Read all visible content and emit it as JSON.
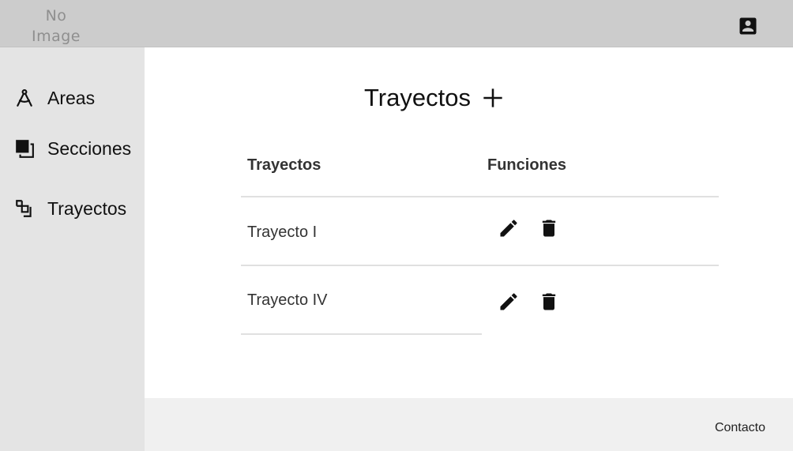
{
  "header": {
    "logo_line1": "No",
    "logo_line2": "Image",
    "account_icon": "account-box-icon"
  },
  "sidebar": {
    "items": [
      {
        "label": "Areas",
        "icon": "compass-icon"
      },
      {
        "label": "Secciones",
        "icon": "layers-icon"
      },
      {
        "label": "Trayectos",
        "icon": "flip-to-front-icon"
      }
    ]
  },
  "main": {
    "title": "Trayectos",
    "add_icon": "plus-icon",
    "table": {
      "columns": [
        "Trayectos",
        "Funciones"
      ],
      "rows": [
        {
          "name": "Trayecto I",
          "actions": [
            "edit-icon",
            "delete-icon"
          ]
        },
        {
          "name": "Trayecto IV",
          "actions": [
            "edit-icon",
            "delete-icon"
          ]
        }
      ]
    }
  },
  "footer": {
    "contact_label": "Contacto"
  },
  "colors": {
    "header_bg": "#cccccc",
    "sidebar_bg": "#e4e4e4",
    "footer_bg": "#f0f0f0",
    "divider": "#e0e0e0"
  }
}
